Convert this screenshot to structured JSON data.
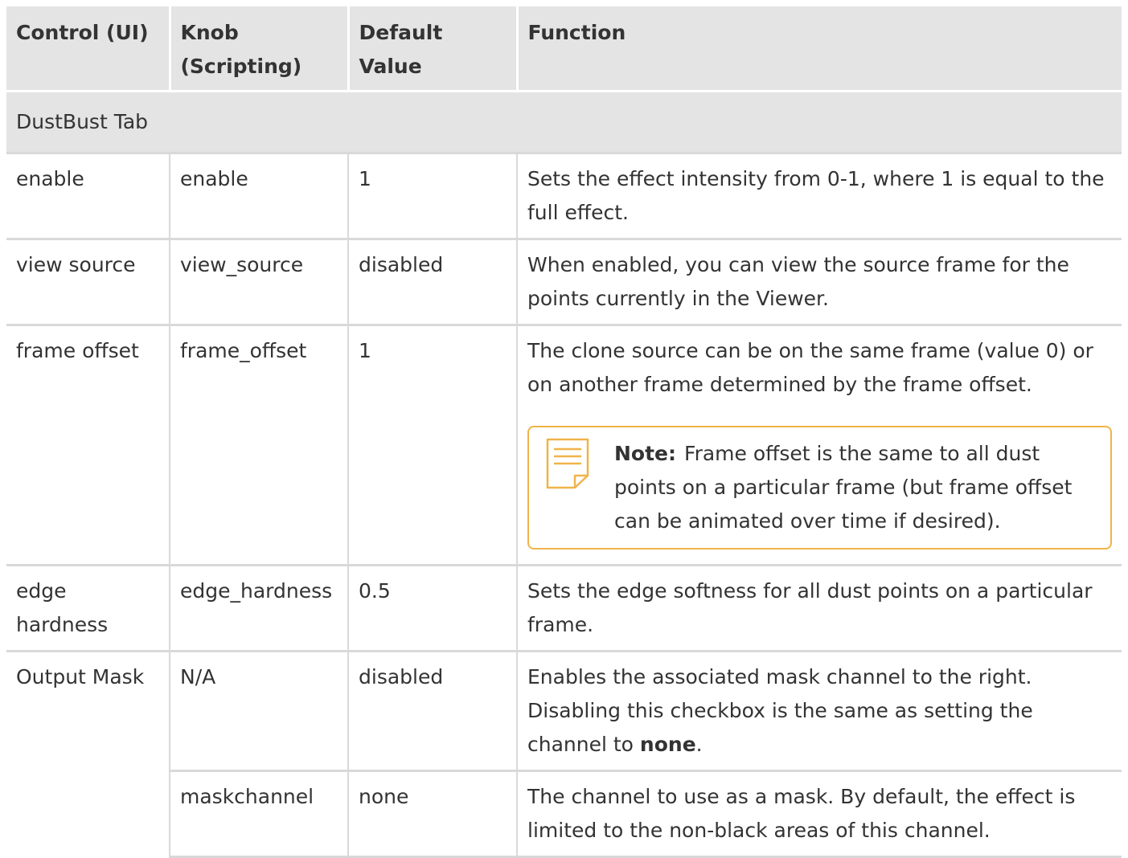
{
  "header": {
    "col1": "Control (UI)",
    "col2_line1": "Knob",
    "col2_line2": "(Scripting)",
    "col3_line1": "Default",
    "col3_line2": "Value",
    "col4": "Function"
  },
  "section": {
    "title": "DustBust Tab"
  },
  "rows": [
    {
      "control": "enable",
      "knob": "enable",
      "default": "1",
      "function": "Sets the effect intensity from 0-1, where 1 is equal to the full effect."
    },
    {
      "control": "view source",
      "knob": "view_source",
      "default": "disabled",
      "function": "When enabled, you can view the source frame for the points currently in the Viewer."
    },
    {
      "control": "frame offset",
      "knob": "frame_offset",
      "default": "1",
      "function": "The clone source can be on the same frame (value 0) or on another frame determined by the frame offset."
    },
    {
      "control": "edge hardness",
      "knob": "edge_hardness",
      "default": "0.5",
      "function": "Sets the edge softness for all dust points on a particular frame."
    },
    {
      "control": "Output Mask",
      "knob": "N/A",
      "default": "disabled",
      "function_pre": "Enables the associated mask channel to the right. Disabling this checkbox is the same as setting the channel to ",
      "function_bold": "none",
      "function_post": "."
    },
    {
      "control": "",
      "knob": "maskchannel",
      "default": "none",
      "function": "The channel to use as a mask. By default, the effect is limited to the non-black areas of this channel."
    }
  ],
  "note": {
    "label": "Note:",
    "text": "Frame offset is the same to all dust points on a particular frame (but frame offset can be animated over time if desired).",
    "icon": "note-icon",
    "border_color": "#f0b44a"
  }
}
